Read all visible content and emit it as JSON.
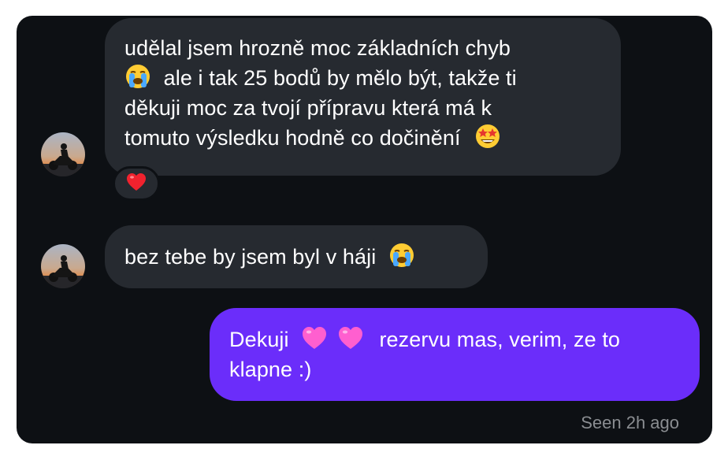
{
  "messages": [
    {
      "direction": "incoming",
      "lines": [
        "udělal jsem hrozně moc základních chyb",
        "ale i tak 25 bodů by mělo být, takže ti",
        "děkuji moc za tvojí přípravu která má k",
        "tomuto výsledku hodně co dočinění"
      ],
      "emojis": [
        "loudly-crying-face-icon",
        "star-struck-face-icon"
      ],
      "reaction": "red-heart-icon"
    },
    {
      "direction": "incoming",
      "text": "bez tebe by jsem byl v háji",
      "emojis": [
        "loudly-crying-face-icon"
      ]
    },
    {
      "direction": "outgoing",
      "lead": "Dekuji",
      "rest": "rezervu mas, verim, ze to",
      "line2": "klapne :)",
      "emojis": [
        "pink-heart-icon",
        "pink-heart-icon"
      ]
    }
  ],
  "status": {
    "seen": "Seen 2h ago"
  },
  "colors": {
    "background": "#0d1014",
    "incoming_bubble": "#262a30",
    "outgoing_bubble": "#6b2dfa",
    "seen_text": "#8a8d91"
  }
}
